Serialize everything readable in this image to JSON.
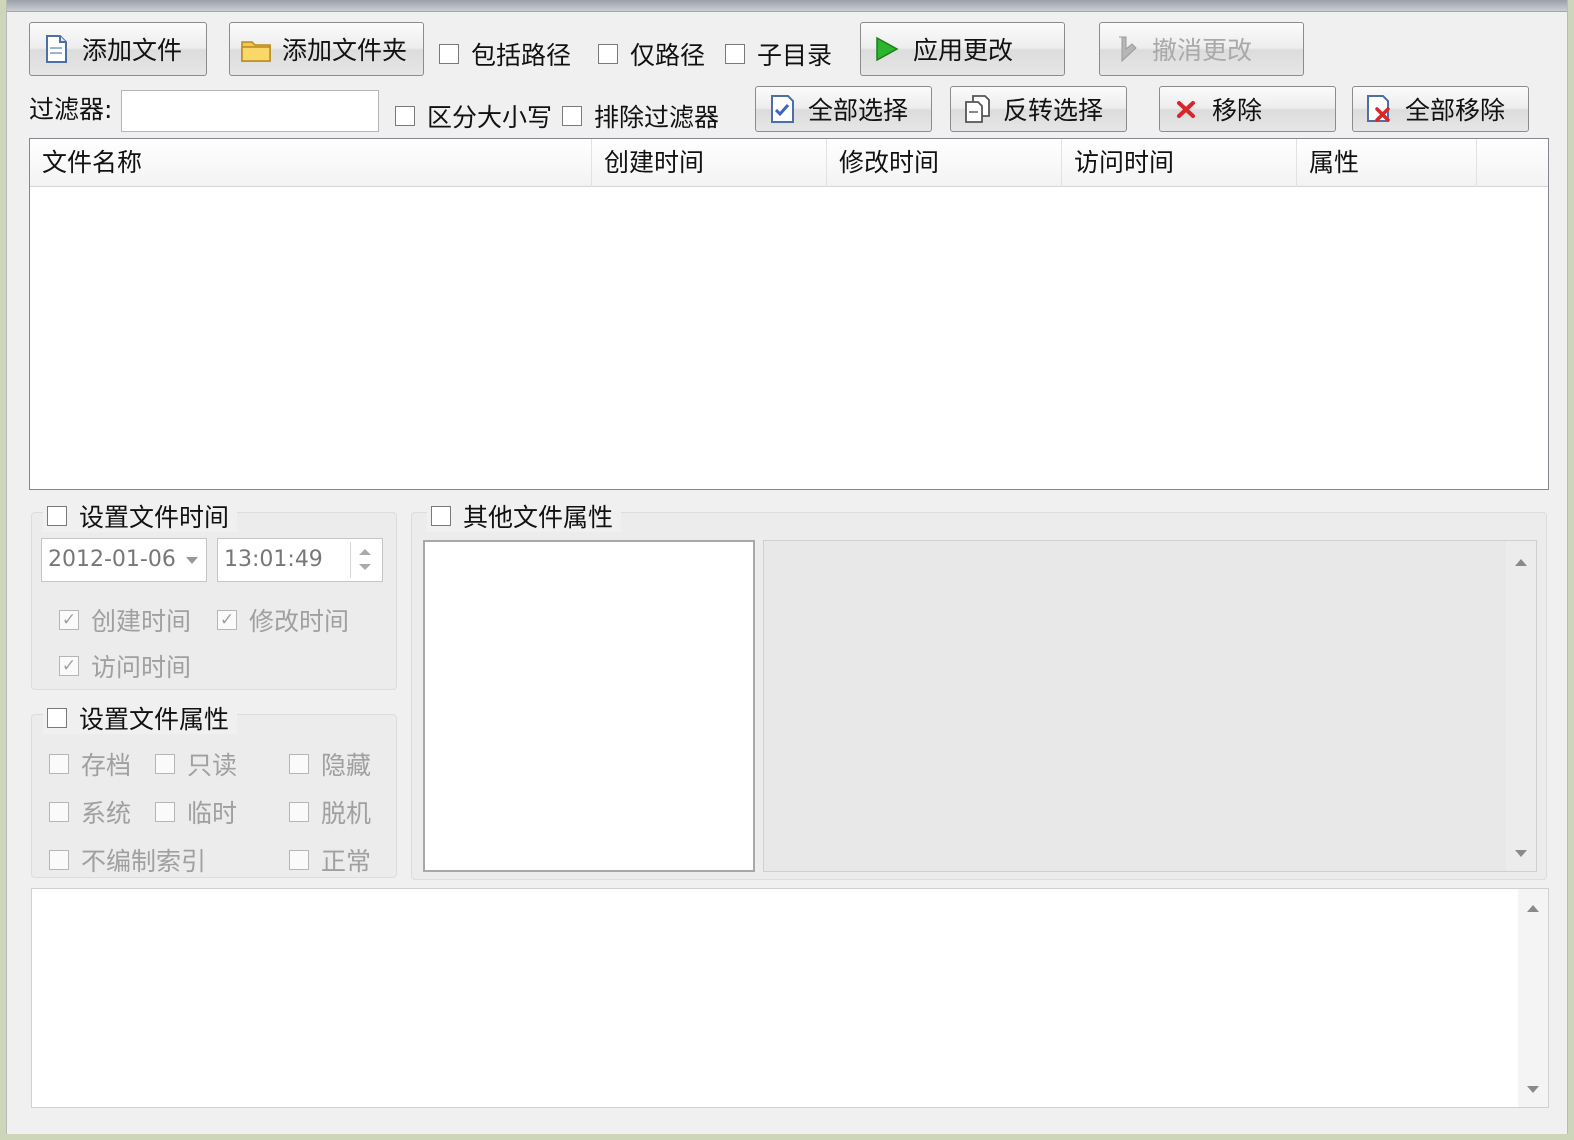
{
  "toolbar": {
    "add_file": "添加文件",
    "add_folder": "添加文件夹",
    "include_path": "包括路径",
    "path_only": "仅路径",
    "subdirectory": "子目录",
    "apply_changes": "应用更改",
    "undo_changes": "撤消更改"
  },
  "filter": {
    "label": "过滤器:",
    "value": "",
    "case_sensitive": "区分大小写",
    "exclude_filter": "排除过滤器",
    "select_all": "全部选择",
    "invert_selection": "反转选择",
    "remove": "移除",
    "remove_all": "全部移除"
  },
  "file_list": {
    "columns": [
      "文件名称",
      "创建时间",
      "修改时间",
      "访问时间",
      "属性"
    ],
    "rows": []
  },
  "set_file_time": {
    "title": "设置文件时间",
    "date": "2012-01-06",
    "time": "13:01:49",
    "created": "创建时间",
    "modified": "修改时间",
    "accessed": "访问时间"
  },
  "set_file_attributes": {
    "title": "设置文件属性",
    "archive": "存档",
    "readonly": "只读",
    "hidden": "隐藏",
    "system": "系统",
    "temporary": "临时",
    "offline": "脱机",
    "not_indexed": "不编制索引",
    "normal": "正常"
  },
  "other_attributes": {
    "title": "其他文件属性"
  },
  "icons": {
    "add_file": "document-icon",
    "add_folder": "folder-icon",
    "apply": "play-icon",
    "undo": "undo-icon",
    "select_all": "check-document-icon",
    "invert": "copy-document-icon",
    "remove": "x-icon",
    "remove_all": "remove-document-icon"
  },
  "colors": {
    "apply_icon": "#2db52d",
    "remove_icon": "#d9262b",
    "disabled_text": "#a9a9a9"
  }
}
